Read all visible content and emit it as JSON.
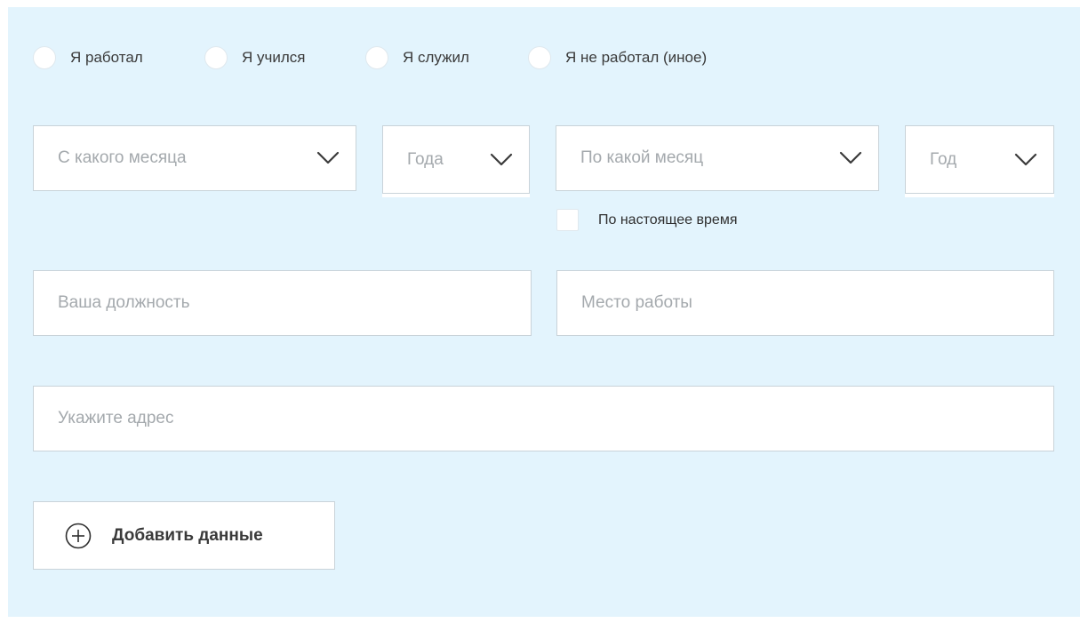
{
  "work_type": {
    "options": [
      {
        "label": "Я работал"
      },
      {
        "label": "Я учился"
      },
      {
        "label": "Я служил"
      },
      {
        "label": "Я не работал (иное)"
      }
    ]
  },
  "period": {
    "from_month": {
      "placeholder": "С какого месяца"
    },
    "from_year": {
      "placeholder": "Года"
    },
    "to_month": {
      "placeholder": "По какой месяц"
    },
    "to_year": {
      "placeholder": "Год"
    },
    "present_label": "По настоящее время"
  },
  "fields": {
    "position_placeholder": "Ваша должность",
    "workplace_placeholder": "Место работы",
    "address_placeholder": "Укажите адрес"
  },
  "actions": {
    "add_label": "Добавить данные"
  },
  "icons": {
    "dropdown": "chevron-down-icon",
    "add": "plus-circle-icon"
  },
  "colors": {
    "panel_background": "#e3f4fd",
    "field_border": "#c9d3d9",
    "placeholder_text": "#a4a9ad",
    "chevron": "#3a3a3a"
  }
}
